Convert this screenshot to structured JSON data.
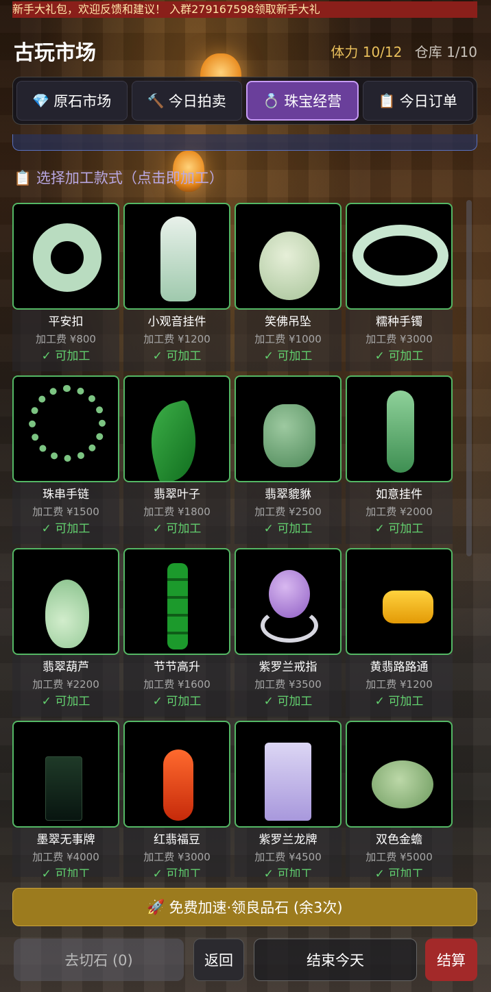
{
  "marquee": "新手大礼包，欢迎反馈和建议！  入群279167598领取新手大礼",
  "header": {
    "title": "古玩市场",
    "stamina": "体力 10/12",
    "storage": "仓库 1/10"
  },
  "tabs": [
    {
      "icon": "💎",
      "label": "原石市场",
      "active": false
    },
    {
      "icon": "🔨",
      "label": "今日拍卖",
      "active": false
    },
    {
      "icon": "💍",
      "label": "珠宝经营",
      "active": true
    },
    {
      "icon": "📋",
      "label": "今日订单",
      "active": false
    }
  ],
  "section": {
    "icon": "📋",
    "title": "选择加工款式（点击即加工）"
  },
  "items": [
    {
      "name": "平安扣",
      "fee": "加工费 ¥800",
      "status": "✓ 可加工",
      "icon": "jade-ring-icon"
    },
    {
      "name": "小观音挂件",
      "fee": "加工费 ¥1200",
      "status": "✓ 可加工",
      "icon": "guanyin-pendant-icon"
    },
    {
      "name": "笑佛吊坠",
      "fee": "加工费 ¥1000",
      "status": "✓ 可加工",
      "icon": "buddha-pendant-icon"
    },
    {
      "name": "糯种手镯",
      "fee": "加工费 ¥3000",
      "status": "✓ 可加工",
      "icon": "bangle-icon"
    },
    {
      "name": "珠串手链",
      "fee": "加工费 ¥1500",
      "status": "✓ 可加工",
      "icon": "bead-bracelet-icon"
    },
    {
      "name": "翡翠叶子",
      "fee": "加工费 ¥1800",
      "status": "✓ 可加工",
      "icon": "jade-leaf-icon"
    },
    {
      "name": "翡翠貔貅",
      "fee": "加工费 ¥2500",
      "status": "✓ 可加工",
      "icon": "pixiu-icon"
    },
    {
      "name": "如意挂件",
      "fee": "加工费 ¥2000",
      "status": "✓ 可加工",
      "icon": "ruyi-pendant-icon"
    },
    {
      "name": "翡翠葫芦",
      "fee": "加工费 ¥2200",
      "status": "✓ 可加工",
      "icon": "gourd-icon"
    },
    {
      "name": "节节高升",
      "fee": "加工费 ¥1600",
      "status": "✓ 可加工",
      "icon": "bamboo-pendant-icon"
    },
    {
      "name": "紫罗兰戒指",
      "fee": "加工费 ¥3500",
      "status": "✓ 可加工",
      "icon": "lavender-ring-icon"
    },
    {
      "name": "黄翡路路通",
      "fee": "加工费 ¥1200",
      "status": "✓ 可加工",
      "icon": "yellow-barrel-icon"
    },
    {
      "name": "墨翠无事牌",
      "fee": "加工费 ¥4000",
      "status": "✓ 可加工",
      "icon": "dark-plaque-icon"
    },
    {
      "name": "红翡福豆",
      "fee": "加工费 ¥3000",
      "status": "✓ 可加工",
      "icon": "red-pea-pod-icon"
    },
    {
      "name": "紫罗兰龙牌",
      "fee": "加工费 ¥4500",
      "status": "✓ 可加工",
      "icon": "dragon-plaque-icon"
    },
    {
      "name": "双色金蟾",
      "fee": "加工费 ¥5000",
      "status": "✓ 可加工",
      "icon": "golden-toad-icon"
    }
  ],
  "buttons": {
    "speed_icon": "🚀",
    "speed": "免费加速·领良品石 (余3次)",
    "cut": "去切石 (0)",
    "back": "返回",
    "end_day": "结束今天",
    "settle": "结算"
  },
  "colors": {
    "accent_purple": "#6a3f9b",
    "card_border": "#54b865",
    "available": "#63d16f",
    "speed_button": "#9c7b1e",
    "settle_button": "#a32929",
    "stamina": "#e9c05c"
  }
}
